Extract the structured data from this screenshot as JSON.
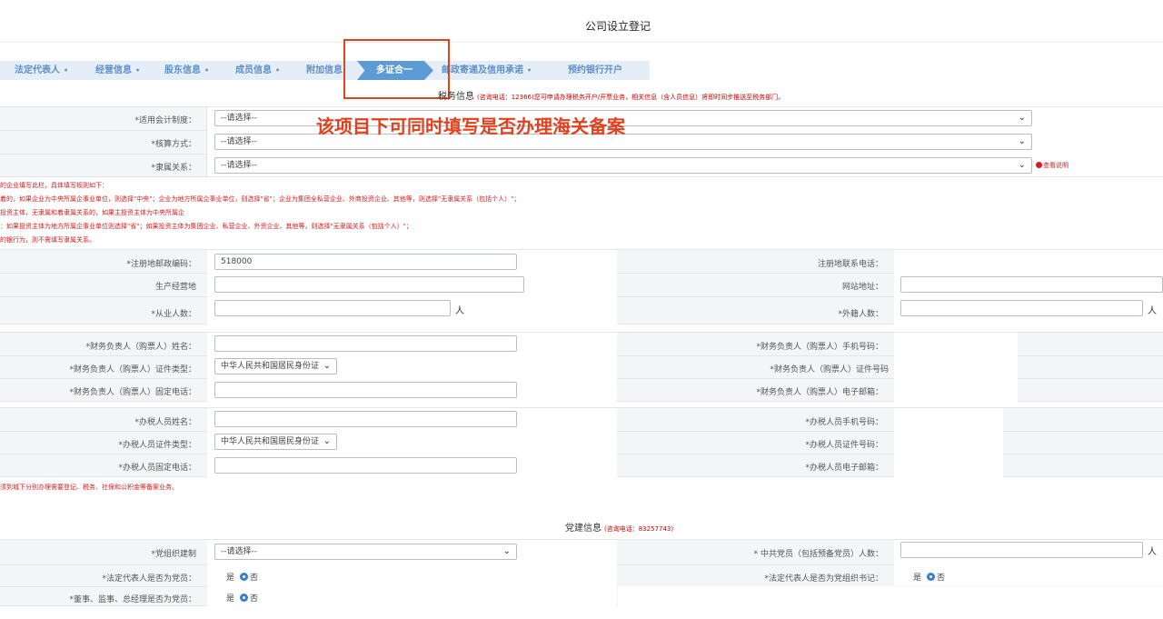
{
  "page_title": "公司设立登记",
  "steps": [
    {
      "label": "法定代表人",
      "dot": "•"
    },
    {
      "label": "经营信息",
      "dot": "•"
    },
    {
      "label": "股东信息",
      "dot": "•"
    },
    {
      "label": "成员信息",
      "dot": "•"
    },
    {
      "label": "附加信息",
      "dot": ""
    },
    {
      "label": "邮政寄递及信用承诺",
      "dot": "•"
    },
    {
      "label": "预约银行开户",
      "dot": ""
    }
  ],
  "active_step": "多证合一",
  "annotation": "该项目下可同时填写是否办理海关备案",
  "tax": {
    "title": "税务信息",
    "note": "(咨询电话：12366)您可申请办理税务开户/开票业务，相关信息（含人员信息）将即时同步推送至税务部门。",
    "accounting_label": "*适用会计制度：",
    "calc_label": "*核算方式：",
    "affil_label": "*隶属关系：",
    "select_placeholder": "--请选择--",
    "help": "查看说明",
    "red_notes": [
      "的企业填写此栏，具体填写规则如下：",
      "着的，如果企业为中央所属企事业单位，则选择\"中央\"；企业为地方所属企事业单位，则选择\"省\"；企业为集团全私营企业、外商投资企业、其他等，则选择\"无隶属关系（包括个人）\"；",
      "投资主体，无隶属和着隶属关系的，如果主投资主体为中央所属企",
      "：如果投资主体为地方所属企事业单位则选择\"省\"；如果投资主体为集团企业、私营企业、外资企业、其他等，则选择\"无隶属关系（包括个人）\"；",
      "的银行为，则不需填写隶属关系。"
    ],
    "postcode_label": "*注册地邮政编码：",
    "postcode_value": "518000",
    "reg_phone_label": "注册地联系电话：",
    "prod_addr_label": "生产经营地",
    "website_label": "网站地址：",
    "employees_label": "*从业人数：",
    "foreign_label": "*外籍人数：",
    "unit": "人",
    "fin_name_label": "*财务负责人（购票人）姓名：",
    "fin_mobile_label": "*财务负责人（购票人）手机号码：",
    "fin_idtype_label": "*财务负责人（购票人）证件类型：",
    "fin_idno_label": "*财务负责人（购票人）证件号码",
    "fin_phone_label": "*财务负责人（购票人）固定电话：",
    "fin_email_label": "*财务负责人（购票人）电子邮箱：",
    "idtype_value": "中华人民共和国居民身份证",
    "tax_name_label": "*办税人员姓名：",
    "tax_mobile_label": "*办税人员手机号码：",
    "tax_idtype_label": "*办税人员证件类型：",
    "tax_idno_label": "*办税人员证件号码：",
    "tax_phone_label": "*办税人员固定电话：",
    "tax_email_label": "*办税人员电子邮箱：",
    "bottom_note": "须到城下分别办理需要登记、税务、社保和公积金等备案业务。"
  },
  "party": {
    "title": "党建信息",
    "note": "(咨询电话：83257743)",
    "org_label": "*党组织建制",
    "org_placeholder": "--请选择--",
    "members_label": "* 中共党员（包括预备党员）人数：",
    "unit": "人",
    "legal_rep_label": "*法定代表人是否为党员：",
    "legal_sec_label": "*法定代表人是否为党组织书记：",
    "directors_label": "*董事、监事、总经理是否为党员：",
    "yes": "是",
    "no": "否"
  },
  "colors": {
    "accent": "#5d9bd5",
    "step_text": "#5d8fc8",
    "required": "#e02020",
    "callout": "#e0421f"
  }
}
